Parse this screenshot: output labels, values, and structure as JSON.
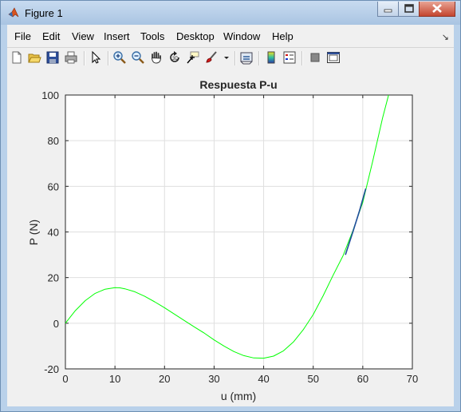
{
  "window": {
    "title": "Figure 1"
  },
  "menu": [
    "File",
    "Edit",
    "View",
    "Insert",
    "Tools",
    "Desktop",
    "Window",
    "Help"
  ],
  "toolbar_icons": [
    "new-figure-icon",
    "open-file-icon",
    "save-icon",
    "print-icon",
    "select-arrow-icon",
    "zoom-in-icon",
    "zoom-out-icon",
    "pan-hand-icon",
    "rotate-3d-icon",
    "data-cursor-icon",
    "brush-icon",
    "link-plot-icon",
    "colorbar-icon",
    "legend-icon",
    "hide-plot-tools-icon",
    "show-plot-tools-icon"
  ],
  "chart_data": {
    "type": "line",
    "title": "Respuesta P-u",
    "xlabel": "u (mm)",
    "ylabel": "P  (N)",
    "xlim": [
      0,
      70
    ],
    "ylim": [
      -20,
      100
    ],
    "xticks": [
      0,
      10,
      20,
      30,
      40,
      50,
      60,
      70
    ],
    "yticks": [
      -20,
      0,
      20,
      40,
      60,
      80,
      100
    ],
    "grid": true,
    "series": [
      {
        "color": "#00ff00",
        "x": [
          0,
          2,
          4,
          6,
          8,
          10,
          11,
          12,
          14,
          16,
          18,
          20,
          22,
          24,
          26,
          28,
          30,
          32,
          34,
          36,
          38,
          40,
          42,
          44,
          46,
          48,
          50,
          52,
          54,
          56,
          58,
          60,
          62,
          64,
          65.2
        ],
        "y": [
          0,
          5.5,
          9.9,
          13.1,
          14.9,
          15.6,
          15.5,
          15.1,
          13.8,
          11.8,
          9.4,
          6.8,
          4.0,
          1.2,
          -1.6,
          -4.3,
          -7.3,
          -10.0,
          -12.4,
          -14.2,
          -15.2,
          -15.3,
          -14.4,
          -12.1,
          -8.2,
          -2.8,
          3.8,
          12.0,
          21.0,
          29.5,
          40.5,
          53.0,
          71.0,
          90.0,
          100
        ]
      },
      {
        "color": "#1f4e9a",
        "x": [
          56.5,
          58,
          59.3,
          60.6
        ],
        "y": [
          30,
          40,
          49,
          59
        ]
      }
    ]
  }
}
